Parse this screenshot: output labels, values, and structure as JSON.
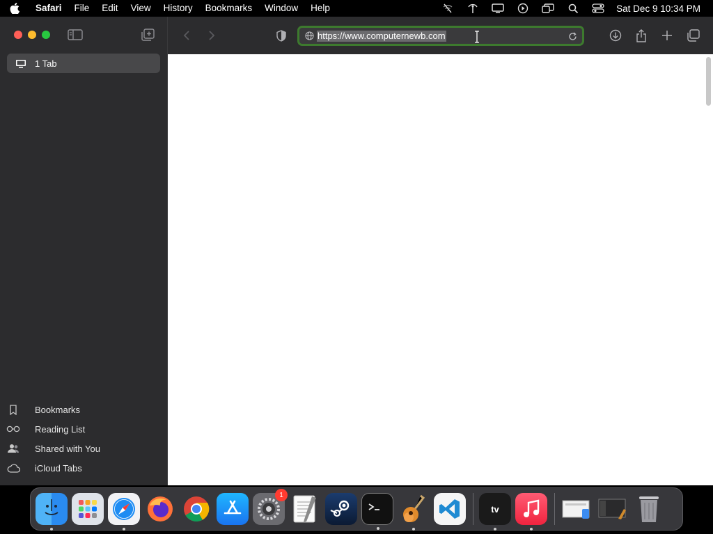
{
  "menubar": {
    "app_name": "Safari",
    "items": [
      "File",
      "Edit",
      "View",
      "History",
      "Bookmarks",
      "Window",
      "Help"
    ],
    "clock": "Sat Dec 9  10:34 PM",
    "status_icons": [
      "wifi-off-icon",
      "antenna-icon",
      "display-icon",
      "play-circle-icon",
      "screen-mirroring-icon",
      "search-icon",
      "control-center-icon"
    ]
  },
  "sidebar": {
    "tab_group_label": "1 Tab",
    "links": [
      {
        "label": "Bookmarks",
        "icon": "bookmark-icon"
      },
      {
        "label": "Reading List",
        "icon": "glasses-icon"
      },
      {
        "label": "Shared with You",
        "icon": "people-icon"
      },
      {
        "label": "iCloud Tabs",
        "icon": "cloud-icon"
      }
    ]
  },
  "toolbar": {
    "url": "https://www.computernewb.com",
    "focus_color": "#3d7a2e"
  },
  "dock": {
    "apps": [
      {
        "name": "finder",
        "running": true
      },
      {
        "name": "launchpad",
        "running": false
      },
      {
        "name": "safari",
        "running": true
      },
      {
        "name": "firefox",
        "running": false
      },
      {
        "name": "chrome",
        "running": false
      },
      {
        "name": "app-store",
        "running": false
      },
      {
        "name": "system-settings",
        "running": false,
        "badge": "1"
      },
      {
        "name": "textedit",
        "running": false
      },
      {
        "name": "steam",
        "running": false
      },
      {
        "name": "terminal",
        "running": true
      },
      {
        "name": "garageband",
        "running": true
      },
      {
        "name": "vscode",
        "running": false
      },
      {
        "name": "apple-tv",
        "running": true,
        "label": "tv"
      },
      {
        "name": "music",
        "running": true
      }
    ]
  }
}
